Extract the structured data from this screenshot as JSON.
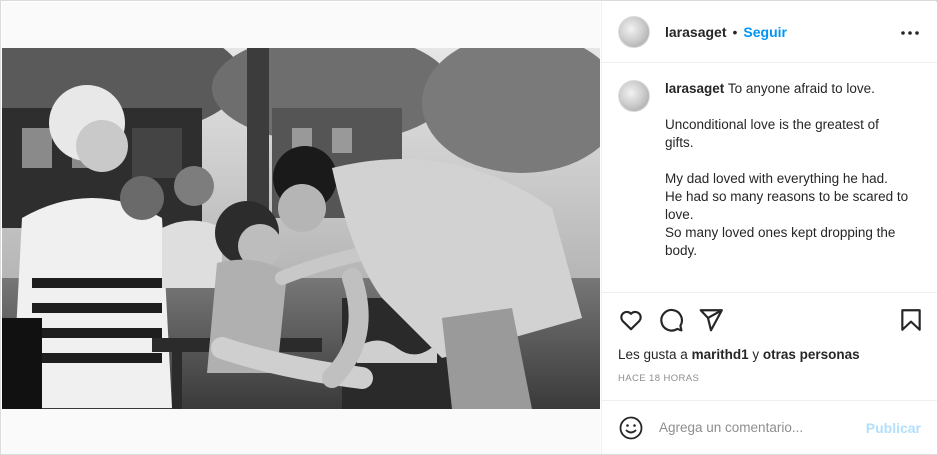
{
  "post": {
    "username": "larasaget",
    "separator": "•",
    "follow_label": "Seguir",
    "more_icon": "more-horizontal-icon",
    "caption": {
      "username": "larasaget",
      "first_line": "To anyone afraid to love.",
      "paragraph_2": [
        "Unconditional love is the greatest of",
        "gifts."
      ],
      "paragraph_3": [
        "My dad loved with everything he had.",
        "He had so many reasons to be scared to",
        "love.",
        "So many loved ones kept dropping the",
        "body."
      ]
    },
    "actions": {
      "like_icon": "heart-icon",
      "comment_icon": "comment-icon",
      "share_icon": "send-icon",
      "save_icon": "bookmark-icon"
    },
    "likes": {
      "prefix": "Les gusta a ",
      "user": "marithd1",
      "middle": " y ",
      "others": "otras personas"
    },
    "timestamp": "HACE 18 HORAS",
    "comment_box": {
      "emoji_icon": "smiley-icon",
      "placeholder": "Agrega un comentario...",
      "publish_label": "Publicar"
    }
  },
  "colors": {
    "accent": "#0095f6",
    "publish_disabled": "#b2dffc",
    "border": "#dbdbdb",
    "muted": "#8e8e8e",
    "text": "#262626"
  }
}
